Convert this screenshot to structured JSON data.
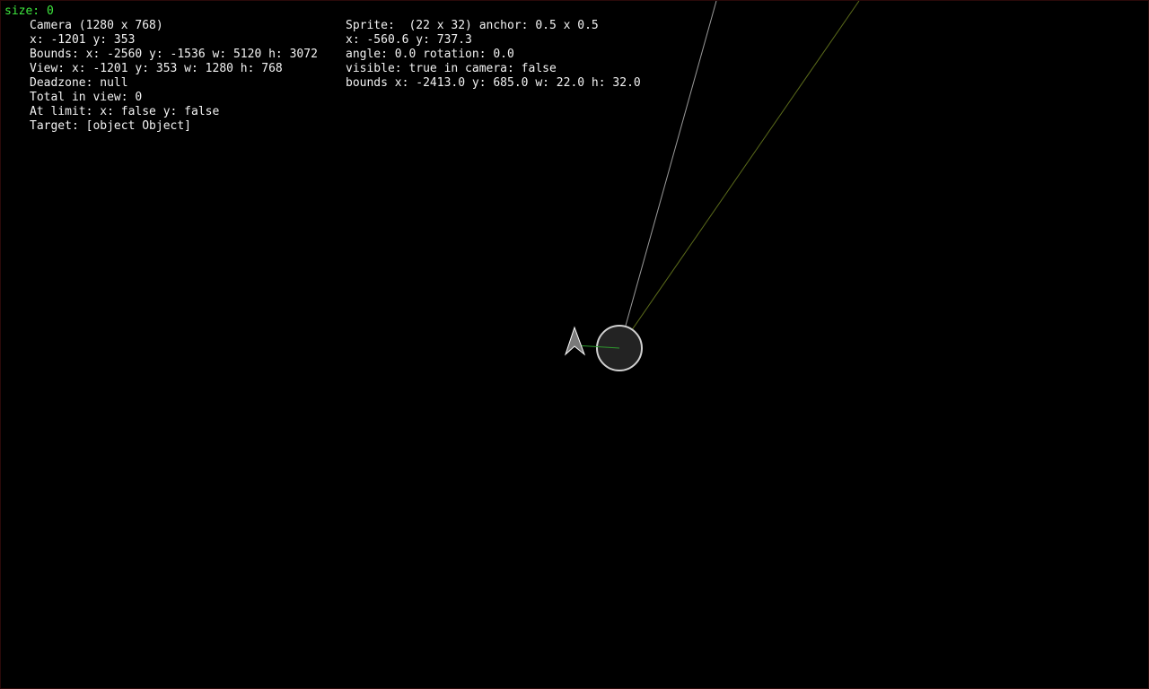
{
  "size_readout": "size: 0",
  "camera": {
    "title": "Camera (1280 x 768)",
    "position": "x: -1201 y: 353",
    "bounds": "Bounds: x: -2560 y: -1536 w: 5120 h: 3072",
    "view": "View: x: -1201 y: 353 w: 1280 h: 768",
    "deadzone": "Deadzone: null",
    "total_in_view": "Total in view: 0",
    "at_limit": "At limit: x: false y: false",
    "target": "Target: [object Object]"
  },
  "sprite": {
    "title": "Sprite:  (22 x 32) anchor: 0.5 x 0.5",
    "position": "x: -560.6 y: 737.3",
    "angle": "angle: 0.0 rotation: 0.0",
    "visibility": "visible: true in camera: false",
    "bounds": "bounds x: -2413.0 y: 685.0 w: 22.0 h: 32.0"
  },
  "colors": {
    "background": "#000000",
    "debug_green": "#3ee83e",
    "text": "#f2f2f2",
    "ray_white": "#9a9a9a",
    "ray_olive": "#5a6a1a",
    "ray_green": "#2e9a2e",
    "circle_fill": "#232323",
    "circle_stroke": "#d0d0d0",
    "ship_fill": "#7a7a7a",
    "ship_stroke": "#ffffff"
  },
  "icons": {
    "ship": "arrowhead-ship-icon",
    "turret": "circle-turret-icon"
  }
}
